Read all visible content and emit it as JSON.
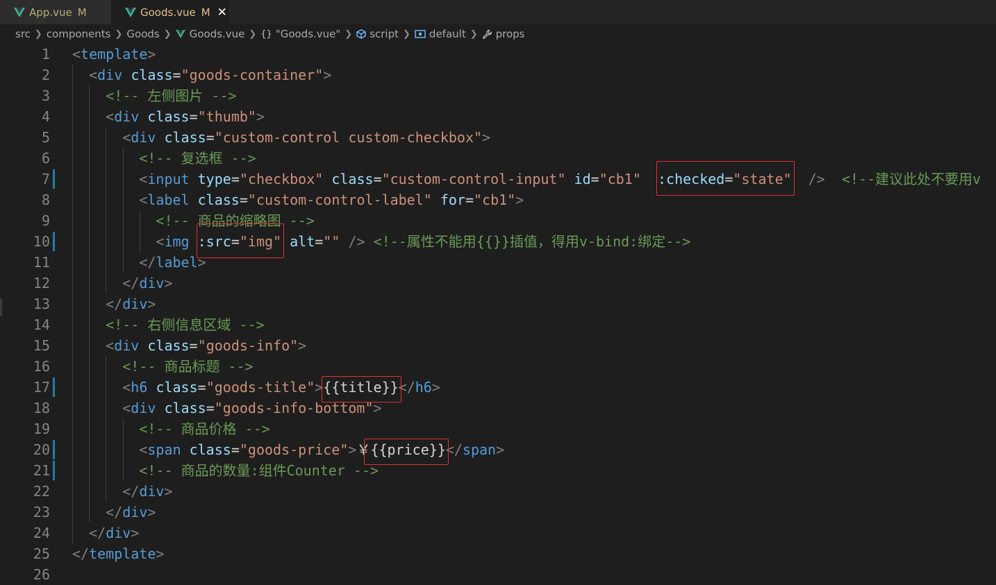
{
  "tabs": [
    {
      "label": "App.vue",
      "status": "M"
    },
    {
      "label": "Goods.vue",
      "status": "M",
      "close": "✕"
    }
  ],
  "breadcrumb": {
    "src": "src",
    "components": "components",
    "goods_folder": "Goods",
    "file": "Goods.vue",
    "obj": "\"Goods.vue\"",
    "script": "script",
    "default": "default",
    "props": "props"
  },
  "code_lines": [
    {
      "n": "1",
      "tokens": [
        [
          "p",
          "<"
        ],
        [
          "t",
          "template"
        ],
        [
          "p",
          ">"
        ]
      ]
    },
    {
      "n": "2",
      "tokens": [
        [
          "x",
          "  "
        ],
        [
          "p",
          "<"
        ],
        [
          "t",
          "div"
        ],
        [
          "x",
          " "
        ],
        [
          "a",
          "class"
        ],
        [
          "e",
          "="
        ],
        [
          "s",
          "\"goods-container\""
        ],
        [
          "p",
          ">"
        ]
      ]
    },
    {
      "n": "3",
      "tokens": [
        [
          "x",
          "    "
        ],
        [
          "c",
          "<!-- 左侧图片 -->"
        ]
      ]
    },
    {
      "n": "4",
      "tokens": [
        [
          "x",
          "    "
        ],
        [
          "p",
          "<"
        ],
        [
          "t",
          "div"
        ],
        [
          "x",
          " "
        ],
        [
          "a",
          "class"
        ],
        [
          "e",
          "="
        ],
        [
          "s",
          "\"thumb\""
        ],
        [
          "p",
          ">"
        ]
      ]
    },
    {
      "n": "5",
      "tokens": [
        [
          "x",
          "      "
        ],
        [
          "p",
          "<"
        ],
        [
          "t",
          "div"
        ],
        [
          "x",
          " "
        ],
        [
          "a",
          "class"
        ],
        [
          "e",
          "="
        ],
        [
          "s",
          "\"custom-control custom-checkbox\""
        ],
        [
          "p",
          ">"
        ]
      ]
    },
    {
      "n": "6",
      "tokens": [
        [
          "x",
          "        "
        ],
        [
          "c",
          "<!-- 复选框 -->"
        ]
      ]
    },
    {
      "n": "7",
      "tokens": [
        [
          "x",
          "        "
        ],
        [
          "p",
          "<"
        ],
        [
          "t",
          "input"
        ],
        [
          "x",
          " "
        ],
        [
          "a",
          "type"
        ],
        [
          "e",
          "="
        ],
        [
          "s",
          "\"checkbox\""
        ],
        [
          "x",
          " "
        ],
        [
          "a",
          "class"
        ],
        [
          "e",
          "="
        ],
        [
          "s",
          "\"custom-control-input\""
        ],
        [
          "x",
          " "
        ],
        [
          "a",
          "id"
        ],
        [
          "e",
          "="
        ],
        [
          "s",
          "\"cb1\""
        ],
        [
          "x",
          "  "
        ],
        [
          "a",
          ":checked"
        ],
        [
          "e",
          "="
        ],
        [
          "s",
          "\"state\""
        ],
        [
          "x",
          "  "
        ],
        [
          "p",
          "/>"
        ],
        [
          "x",
          "  "
        ],
        [
          "c",
          "<!--建议此处不要用v"
        ]
      ]
    },
    {
      "n": "8",
      "tokens": [
        [
          "x",
          "        "
        ],
        [
          "p",
          "<"
        ],
        [
          "t",
          "label"
        ],
        [
          "x",
          " "
        ],
        [
          "a",
          "class"
        ],
        [
          "e",
          "="
        ],
        [
          "s",
          "\"custom-control-label\""
        ],
        [
          "x",
          " "
        ],
        [
          "a",
          "for"
        ],
        [
          "e",
          "="
        ],
        [
          "s",
          "\"cb1\""
        ],
        [
          "p",
          ">"
        ]
      ]
    },
    {
      "n": "9",
      "tokens": [
        [
          "x",
          "          "
        ],
        [
          "c",
          "<!-- 商品的缩略图 -->"
        ]
      ]
    },
    {
      "n": "10",
      "tokens": [
        [
          "x",
          "          "
        ],
        [
          "p",
          "<"
        ],
        [
          "t",
          "img"
        ],
        [
          "x",
          " "
        ],
        [
          "a",
          ":src"
        ],
        [
          "e",
          "="
        ],
        [
          "s",
          "\"img\""
        ],
        [
          "x",
          " "
        ],
        [
          "a",
          "alt"
        ],
        [
          "e",
          "="
        ],
        [
          "s",
          "\"\""
        ],
        [
          "x",
          " "
        ],
        [
          "p",
          "/>"
        ],
        [
          "x",
          " "
        ],
        [
          "c",
          "<!--属性不能用{{}}插值，得用v-bind:绑定-->"
        ]
      ]
    },
    {
      "n": "11",
      "tokens": [
        [
          "x",
          "        "
        ],
        [
          "p",
          "</"
        ],
        [
          "t",
          "label"
        ],
        [
          "p",
          ">"
        ]
      ]
    },
    {
      "n": "12",
      "tokens": [
        [
          "x",
          "      "
        ],
        [
          "p",
          "</"
        ],
        [
          "t",
          "div"
        ],
        [
          "p",
          ">"
        ]
      ]
    },
    {
      "n": "13",
      "tokens": [
        [
          "x",
          "    "
        ],
        [
          "p",
          "</"
        ],
        [
          "t",
          "div"
        ],
        [
          "p",
          ">"
        ]
      ]
    },
    {
      "n": "14",
      "tokens": [
        [
          "x",
          "    "
        ],
        [
          "c",
          "<!-- 右侧信息区域 -->"
        ]
      ]
    },
    {
      "n": "15",
      "tokens": [
        [
          "x",
          "    "
        ],
        [
          "p",
          "<"
        ],
        [
          "t",
          "div"
        ],
        [
          "x",
          " "
        ],
        [
          "a",
          "class"
        ],
        [
          "e",
          "="
        ],
        [
          "s",
          "\"goods-info\""
        ],
        [
          "p",
          ">"
        ]
      ]
    },
    {
      "n": "16",
      "tokens": [
        [
          "x",
          "      "
        ],
        [
          "c",
          "<!-- 商品标题 -->"
        ]
      ]
    },
    {
      "n": "17",
      "tokens": [
        [
          "x",
          "      "
        ],
        [
          "p",
          "<"
        ],
        [
          "t",
          "h6"
        ],
        [
          "x",
          " "
        ],
        [
          "a",
          "class"
        ],
        [
          "e",
          "="
        ],
        [
          "s",
          "\"goods-title\""
        ],
        [
          "p",
          ">"
        ],
        [
          "d",
          "{{title}}"
        ],
        [
          "p",
          "</"
        ],
        [
          "t",
          "h6"
        ],
        [
          "p",
          ">"
        ]
      ]
    },
    {
      "n": "18",
      "tokens": [
        [
          "x",
          "      "
        ],
        [
          "p",
          "<"
        ],
        [
          "t",
          "div"
        ],
        [
          "x",
          " "
        ],
        [
          "a",
          "class"
        ],
        [
          "e",
          "="
        ],
        [
          "s",
          "\"goods-info-bottom\""
        ],
        [
          "p",
          ">"
        ]
      ]
    },
    {
      "n": "19",
      "tokens": [
        [
          "x",
          "        "
        ],
        [
          "c",
          "<!-- 商品价格 -->"
        ]
      ]
    },
    {
      "n": "20",
      "tokens": [
        [
          "x",
          "        "
        ],
        [
          "p",
          "<"
        ],
        [
          "t",
          "span"
        ],
        [
          "x",
          " "
        ],
        [
          "a",
          "class"
        ],
        [
          "e",
          "="
        ],
        [
          "s",
          "\"goods-price\""
        ],
        [
          "p",
          ">"
        ],
        [
          "d",
          "￥{{price}}"
        ],
        [
          "p",
          "</"
        ],
        [
          "t",
          "span"
        ],
        [
          "p",
          ">"
        ]
      ]
    },
    {
      "n": "21",
      "tokens": [
        [
          "x",
          "        "
        ],
        [
          "c",
          "<!-- 商品的数量:组件Counter -->"
        ]
      ]
    },
    {
      "n": "22",
      "tokens": [
        [
          "x",
          "      "
        ],
        [
          "p",
          "</"
        ],
        [
          "t",
          "div"
        ],
        [
          "p",
          ">"
        ]
      ]
    },
    {
      "n": "23",
      "tokens": [
        [
          "x",
          "    "
        ],
        [
          "p",
          "</"
        ],
        [
          "t",
          "div"
        ],
        [
          "p",
          ">"
        ]
      ]
    },
    {
      "n": "24",
      "tokens": [
        [
          "x",
          "  "
        ],
        [
          "p",
          "</"
        ],
        [
          "t",
          "div"
        ],
        [
          "p",
          ">"
        ]
      ]
    },
    {
      "n": "25",
      "tokens": [
        [
          "p",
          "</"
        ],
        [
          "t",
          "template"
        ],
        [
          "p",
          ">"
        ]
      ]
    },
    {
      "n": "26",
      "tokens": []
    }
  ],
  "modified_lines": [
    "7",
    "10",
    "17",
    "20",
    "21"
  ],
  "colors": {
    "background": "#1e1e1e",
    "tag": "#569cd6",
    "attribute": "#9cdcfe",
    "string": "#ce9178",
    "comment": "#6a9955",
    "highlight_box": "#e03232"
  }
}
